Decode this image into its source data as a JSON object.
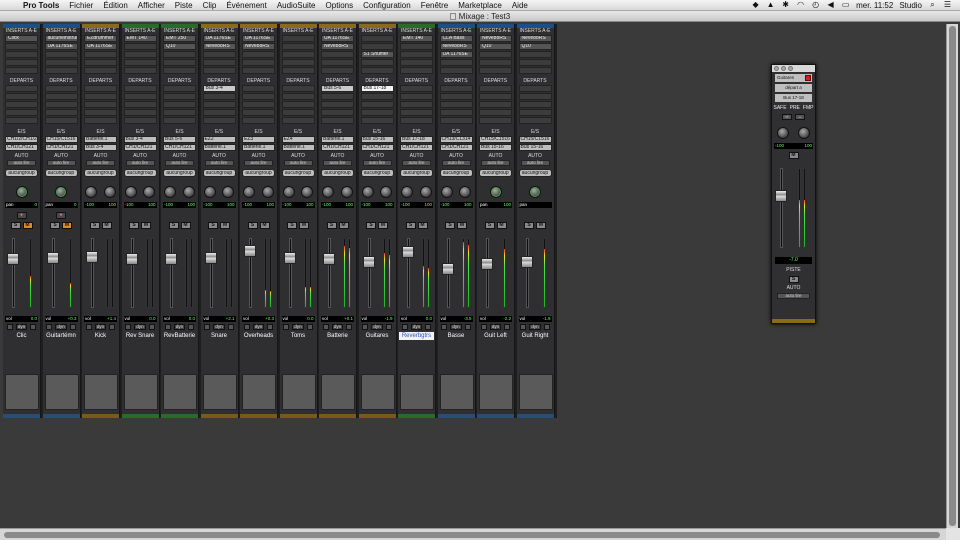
{
  "menubar": {
    "app": "Pro Tools",
    "items": [
      "Fichier",
      "Édition",
      "Afficher",
      "Piste",
      "Clip",
      "Événement",
      "AudioSuite",
      "Options",
      "Configuration",
      "Fenêtre",
      "Marketplace",
      "Aide"
    ],
    "battery_count": "10",
    "clock": "mer. 11:52",
    "user": "Studio"
  },
  "window": {
    "title": "Mixage : Test3"
  },
  "labels": {
    "inserts": "INSERTS A-E",
    "sends": "DEPARTS",
    "io": "E/S",
    "auto": "AUTO",
    "pan": "pan",
    "vol": "vol",
    "dyn": "dyn",
    "solo": "S",
    "mute": "M",
    "rec": "●"
  },
  "strips": [
    {
      "name": "Clic",
      "color": "#1b4f8a",
      "bottom": "#2a4d78",
      "inserts": [
        "Click",
        "",
        ""
      ],
      "sends": [
        "",
        ""
      ],
      "in": "CH1/2/CH1/2",
      "out": "CH1/CH121",
      "auto": "auto lire",
      "group": "aucungroup",
      "pan_l": "",
      "pan_r": "0",
      "vol": "0.0",
      "meter": 0.45,
      "fader": 0.22,
      "muted": true,
      "rec": true,
      "sel": false,
      "mono": true
    },
    {
      "name": "Guitartémn",
      "color": "#1b4f8a",
      "bottom": "#2a4d78",
      "inserts": [
        "aucuneinstrume",
        "UA 1176SE",
        ""
      ],
      "sends": [
        "",
        ""
      ],
      "in": "CH15/C1516",
      "out": "CH1/CH121",
      "auto": "auto lire",
      "group": "aucungroup",
      "pan_l": "",
      "pan_r": "0",
      "vol": "+0.3",
      "meter": 0.35,
      "fader": 0.2,
      "muted": true,
      "rec": true,
      "sel": false,
      "mono": true
    },
    {
      "name": "Kick",
      "color": "#8a6a1b",
      "bottom": "#7a5a1b",
      "inserts": [
        "EZdrummer",
        "UA 1176SE",
        ""
      ],
      "sends": [
        "",
        ""
      ],
      "in": "Batterie.1",
      "out": "Bus 3-4",
      "auto": "auto lire",
      "group": "aucungroup",
      "pan_l": "-100",
      "pan_r": "100",
      "vol": "+1.4",
      "meter": 0.0,
      "fader": 0.18,
      "muted": false,
      "rec": false,
      "sel": false,
      "mono": false
    },
    {
      "name": "Rev Snare",
      "color": "#2a6a2a",
      "bottom": "#2a6a2a",
      "inserts": [
        "EMT 140",
        "",
        ""
      ],
      "sends": [
        "",
        ""
      ],
      "in": "Bus 3-4",
      "out": "CH1/CH121",
      "auto": "auto lire",
      "group": "aucungroup",
      "pan_l": "-100",
      "pan_r": "100",
      "vol": "0.0",
      "meter": 0.0,
      "fader": 0.22,
      "muted": false,
      "rec": false,
      "sel": false,
      "mono": false
    },
    {
      "name": "RevBatterie",
      "color": "#2a6a2a",
      "bottom": "#2a6a2a",
      "inserts": [
        "EMT 250",
        "Q10",
        ""
      ],
      "sends": [
        "",
        ""
      ],
      "in": "Bus 5-6",
      "out": "CH1/CH121",
      "auto": "auto lire",
      "group": "aucungroup",
      "pan_l": "-100",
      "pan_r": "100",
      "vol": "0.0",
      "meter": 0.0,
      "fader": 0.22,
      "muted": false,
      "rec": false,
      "sel": false,
      "mono": false
    },
    {
      "name": "Snare",
      "color": "#8a6a1b",
      "bottom": "#7a5a1b",
      "inserts": [
        "UA 1176SE",
        "Neve88RS",
        ""
      ],
      "sends": [
        "Bus 3-4",
        ""
      ],
      "in": "EZ2",
      "out": "Batterie.1",
      "auto": "auto lire",
      "group": "aucungroup",
      "pan_l": "-100",
      "pan_r": "100",
      "vol": "+2.1",
      "meter": 0.0,
      "fader": 0.2,
      "muted": false,
      "rec": false,
      "sel": false,
      "mono": false
    },
    {
      "name": "Overheads",
      "color": "#8a6a1b",
      "bottom": "#7a5a1b",
      "inserts": [
        "UA 1176SE",
        "Neve88RS",
        ""
      ],
      "sends": [
        "",
        ""
      ],
      "in": "EZ3",
      "out": "Batterie.1",
      "auto": "auto lire",
      "group": "aucungroup",
      "pan_l": "-100",
      "pan_r": "100",
      "vol": "+0.3",
      "meter": 0.25,
      "fader": 0.1,
      "muted": false,
      "rec": false,
      "sel": false,
      "mono": false
    },
    {
      "name": "Toms",
      "color": "#8a6a1b",
      "bottom": "#7a5a1b",
      "inserts": [
        "",
        "",
        ""
      ],
      "sends": [
        "",
        ""
      ],
      "in": "EZ4",
      "out": "Batterie.1",
      "auto": "auto lire",
      "group": "aucungroup",
      "pan_l": "-100",
      "pan_r": "100",
      "vol": "0.0",
      "meter": 0.3,
      "fader": 0.2,
      "muted": false,
      "rec": false,
      "sel": false,
      "mono": false
    },
    {
      "name": "Batterie",
      "color": "#8a6a1b",
      "bottom": "#7a5a1b",
      "inserts": [
        "UA 1176SE",
        "Neve88RS",
        ""
      ],
      "sends": [
        "Bus 5-6",
        ""
      ],
      "in": "Batterie.1",
      "out": "CH1/CH121",
      "auto": "auto lire",
      "group": "aucungroup",
      "pan_l": "-100",
      "pan_r": "100",
      "vol": "+0.1",
      "meter": 0.9,
      "fader": 0.22,
      "muted": false,
      "rec": false,
      "sel": false,
      "mono": false
    },
    {
      "name": "Guitares",
      "color": "#8a6a1b",
      "bottom": "#7a5a1b",
      "inserts": [
        "",
        "",
        "S1 Shuffler"
      ],
      "sends": [
        "Bus 17-18",
        ""
      ],
      "in": "Bus 15-16",
      "out": "CH1/CH121",
      "auto": "auto lire",
      "group": "aucungroup",
      "pan_l": "-100",
      "pan_r": "100",
      "vol": "-1.9",
      "meter": 0.8,
      "fader": 0.25,
      "muted": false,
      "rec": false,
      "sel": false,
      "mono": false
    },
    {
      "name": "Reverbgtrs",
      "color": "#2a6a2a",
      "bottom": "#2a6a2a",
      "inserts": [
        "EMT 140",
        "",
        ""
      ],
      "sends": [
        "",
        ""
      ],
      "in": "Bus 17-18",
      "out": "CH1/CH121",
      "auto": "auto lire",
      "group": "aucungroup",
      "pan_l": "-100",
      "pan_r": "100",
      "vol": "0.0",
      "meter": 0.6,
      "fader": 0.12,
      "muted": false,
      "rec": false,
      "sel": true,
      "mono": false
    },
    {
      "name": "Basse",
      "color": "#1b4f8a",
      "bottom": "#2a4d78",
      "inserts": [
        "CLA Bass",
        "Neve88RS",
        "UA 1176SE"
      ],
      "sends": [
        "",
        ""
      ],
      "in": "CH13/C1314",
      "out": "CH1/CH121",
      "auto": "auto lire",
      "group": "aucungroup",
      "pan_l": "-100",
      "pan_r": "100",
      "vol": "-3.5",
      "meter": 0.95,
      "fader": 0.35,
      "muted": false,
      "rec": false,
      "sel": false,
      "mono": false
    },
    {
      "name": "Guit Left",
      "color": "#1b4f8a",
      "bottom": "#2a4d78",
      "inserts": [
        "Neve88RS",
        "Q10",
        ""
      ],
      "sends": [
        "",
        ""
      ],
      "in": "CH15/C1516",
      "out": "Bus 15-16",
      "auto": "auto lire",
      "group": "aucungroup",
      "pan_l": "",
      "pan_r": "100",
      "vol": "-2.2",
      "meter": 0.85,
      "fader": 0.28,
      "muted": false,
      "rec": false,
      "sel": false,
      "mono": true
    },
    {
      "name": "Guit Right",
      "color": "#1b4f8a",
      "bottom": "#2a4d78",
      "inserts": [
        "Neve88RS",
        "Q10",
        ""
      ],
      "sends": [
        "",
        ""
      ],
      "in": "CH15/C1516",
      "out": "Bus 15-16",
      "auto": "auto lire",
      "group": "aucungroup",
      "pan_l": "-100",
      "pan_r": "",
      "vol": "-1.9",
      "meter": 0.85,
      "fader": 0.25,
      "muted": false,
      "rec": false,
      "sel": false,
      "mono": true
    }
  ],
  "output_window": {
    "track": "Guitares",
    "send": "départ a",
    "bus": "Bus 17-18",
    "safe": "SAFE",
    "pre": "PRE",
    "fmp": "FMP",
    "pan_l": "-100",
    "pan_r": "100",
    "mute": "M",
    "level": "-7.0",
    "piste": "PISTE",
    "solo": "S",
    "auto": "AUTO",
    "auto_mode": "auto lire",
    "meter": 0.6
  }
}
